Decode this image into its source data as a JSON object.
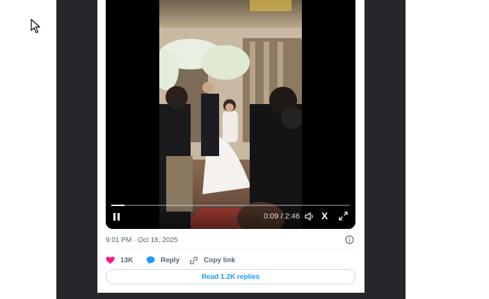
{
  "video": {
    "time_current": "0:09",
    "time_separator": " / ",
    "time_total": "2:46",
    "progress": 0.054,
    "x_label": "X"
  },
  "post": {
    "timestamp": "9:01 PM · Oct 18, 2025"
  },
  "actions": {
    "likes": "13K",
    "reply": "Reply",
    "copy_link": "Copy link"
  },
  "read_replies": "Read 1.2K replies",
  "colors": {
    "like": "#f91880",
    "reply": "#1d9bf0",
    "accent": "#1d9bf0",
    "panel": "#25272b"
  }
}
